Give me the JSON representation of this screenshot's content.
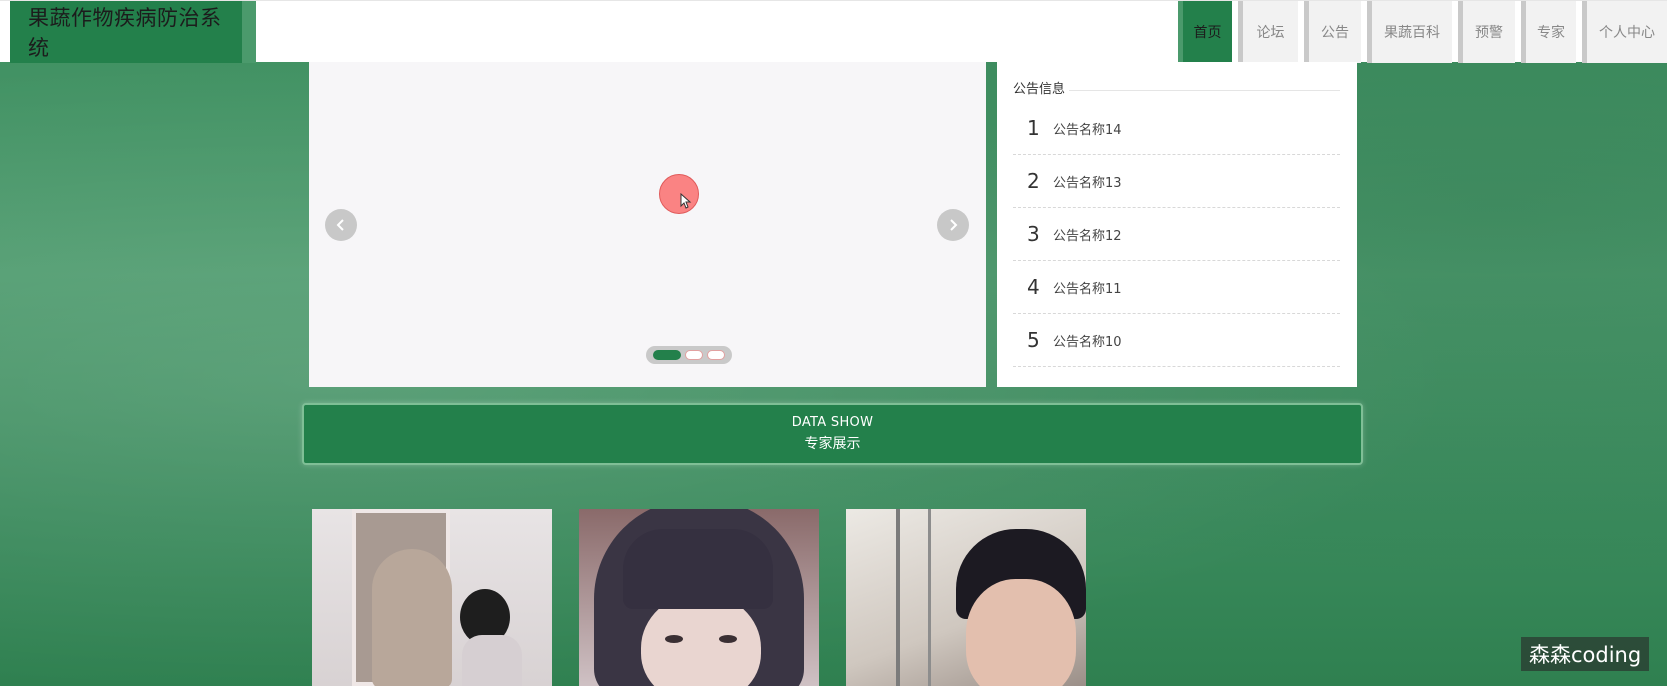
{
  "header": {
    "title": "果蔬作物疾病防治系统",
    "nav": [
      {
        "label": "首页",
        "active": true
      },
      {
        "label": "论坛",
        "active": false
      },
      {
        "label": "公告",
        "active": false
      },
      {
        "label": "果蔬百科",
        "active": false
      },
      {
        "label": "预警",
        "active": false
      },
      {
        "label": "专家",
        "active": false
      },
      {
        "label": "个人中心",
        "active": false
      }
    ]
  },
  "carousel": {
    "prev_icon": "chevron-left-icon",
    "next_icon": "chevron-right-icon",
    "slide_count": 3,
    "active_index": 0
  },
  "notices": {
    "title": "公告信息",
    "items": [
      {
        "num": "1",
        "title": "公告名称14"
      },
      {
        "num": "2",
        "title": "公告名称13"
      },
      {
        "num": "3",
        "title": "公告名称12"
      },
      {
        "num": "4",
        "title": "公告名称11"
      },
      {
        "num": "5",
        "title": "公告名称10"
      }
    ]
  },
  "banner": {
    "en": "DATA SHOW",
    "cn": "专家展示"
  },
  "experts": [
    {
      "photo": "expert-photo-1"
    },
    {
      "photo": "expert-photo-2"
    },
    {
      "photo": "expert-photo-3"
    }
  ],
  "watermark": "森森coding",
  "colors": {
    "primary": "#23804b",
    "accent": "#4b9a6c",
    "background": "#3e8f60"
  }
}
